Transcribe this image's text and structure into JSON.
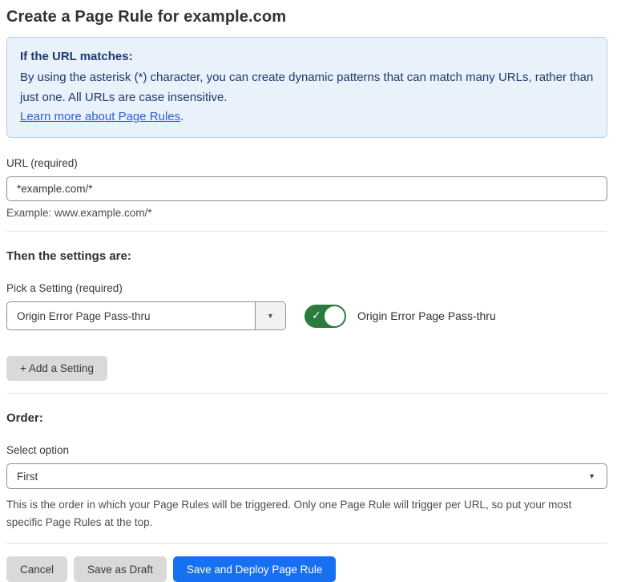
{
  "page": {
    "title": "Create a Page Rule for example.com"
  },
  "info_box": {
    "heading": "If the URL matches:",
    "body": "By using the asterisk (*) character, you can create dynamic patterns that can match many URLs, rather than just one. All URLs are case insensitive.",
    "link_label": "Learn more about Page Rules",
    "link_suffix": "."
  },
  "url_field": {
    "label": "URL (required)",
    "value": "*example.com/*",
    "example": "Example: www.example.com/*"
  },
  "settings_section": {
    "heading": "Then the settings are:",
    "picker_label": "Pick a Setting (required)",
    "picker_value": "Origin Error Page Pass-thru",
    "picker_arrow": "▼",
    "toggle_state": "on",
    "toggle_check": "✓",
    "toggle_label": "Origin Error Page Pass-thru",
    "add_setting_label": "+ Add a Setting"
  },
  "order_section": {
    "heading": "Order:",
    "select_label": "Select option",
    "select_value": "First",
    "select_arrow": "▼",
    "help_text": "This is the order in which your Page Rules will be triggered. Only one Page Rule will trigger per URL, so put your most specific Page Rules at the top."
  },
  "footer": {
    "cancel_label": "Cancel",
    "save_draft_label": "Save as Draft",
    "save_deploy_label": "Save and Deploy Page Rule"
  },
  "colors": {
    "info_background": "#e9f1fb",
    "info_border": "#b5cdec",
    "info_text": "#1e3a6d",
    "link_blue": "#2b62c9",
    "toggle_green": "#2b7a3e",
    "primary_button_blue": "#176ff2",
    "secondary_button_gray": "#d9d9d9",
    "input_border_gray": "#8f8f8f"
  }
}
